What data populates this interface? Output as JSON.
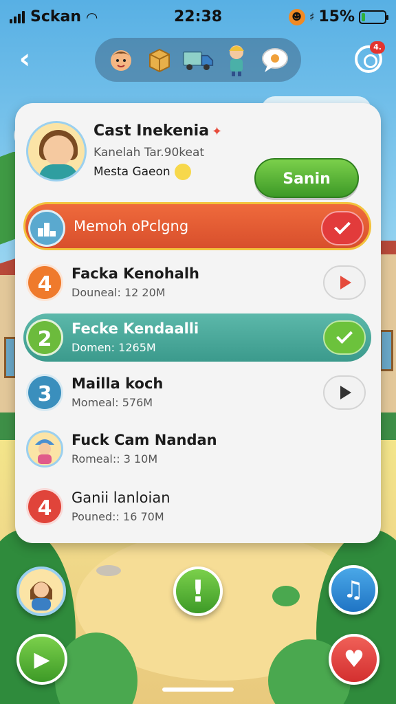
{
  "status": {
    "carrier": "Sckan",
    "time": "22:38",
    "battery": "15%",
    "battery_level": 0.15,
    "signal_icon": "signal-bars-icon",
    "wifi_icon": "wifi-icon",
    "bluetooth": "♯"
  },
  "nav": {
    "back": "‹",
    "icons": [
      "character-icon",
      "package-icon",
      "truck-icon",
      "worker-icon",
      "chat-icon"
    ],
    "notification_badge": "4."
  },
  "profile": {
    "name": "Cast Inekenia",
    "subtitle": "Kanelah Tar.90keat",
    "location": "Mesta Gaeon",
    "action_label": "Sanin"
  },
  "rows": [
    {
      "badge": "",
      "title": "Memoh oPclgng",
      "meta": ""
    },
    {
      "badge": "4",
      "title": "Facka Kenohalh",
      "meta": "Douneal: 12 20M"
    },
    {
      "badge": "2",
      "title": "Fecke Kendaalli",
      "meta": "Domen: 1265M"
    },
    {
      "badge": "3",
      "title": "Mailla koch",
      "meta": "Momeal: 576M"
    },
    {
      "badge": "",
      "title": "Fuck Cam Nandan",
      "meta": "Romeal:: 3 10M"
    },
    {
      "badge": "4",
      "title": "Ganii lanloian",
      "meta": "Pouned:: 16 70M"
    }
  ],
  "controls": {
    "alert": "!",
    "music": "♫",
    "next": "▶",
    "heart": "♥"
  },
  "colors": {
    "primary_green": "#4caf2f",
    "active_red": "#e05a32",
    "active_teal": "#4aa99b",
    "badge_orange": "#ef7a2c",
    "badge_blue": "#3a8fbd",
    "badge_red": "#e0443a"
  }
}
